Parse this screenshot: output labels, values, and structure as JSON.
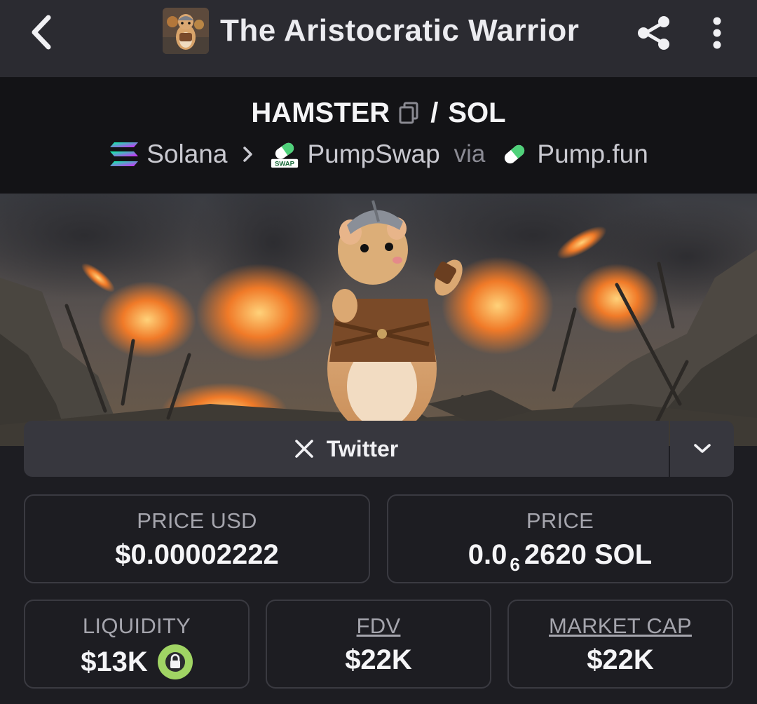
{
  "header": {
    "title": "The Aristocratic Warrior",
    "back_icon": "chevron-left-icon",
    "share_icon": "share-icon",
    "more_icon": "vertical-dots-icon"
  },
  "pair": {
    "base": "HAMSTER",
    "separator": "/",
    "quote": "SOL",
    "copy_icon": "copy-icon"
  },
  "route": {
    "chain": "Solana",
    "dex": "PumpSwap",
    "dex_badge": "SWAP",
    "via": "via",
    "launchpad": "Pump.fun"
  },
  "banner": {
    "image": "hamster-warrior-battlefield"
  },
  "links": {
    "twitter_label": "Twitter",
    "twitter_icon": "x-logo-icon",
    "dropdown_icon": "chevron-down-icon"
  },
  "stats": {
    "price_usd_label": "PRICE USD",
    "price_usd_value": "$0.00002222",
    "price_label": "PRICE",
    "price_prefix": "0.0",
    "price_zero_count": "6",
    "price_suffix": "2620 SOL",
    "liquidity_label": "LIQUIDITY",
    "liquidity_value": "$13K",
    "liquidity_icon": "lock-icon",
    "fdv_label": "FDV",
    "fdv_value": "$22K",
    "mcap_label": "MARKET CAP",
    "mcap_value": "$22K"
  },
  "colors": {
    "background": "#1d1d22",
    "topbar": "#2b2b31",
    "pairbar": "#131316",
    "button": "#37373e",
    "lock_green": "#a0d464"
  }
}
